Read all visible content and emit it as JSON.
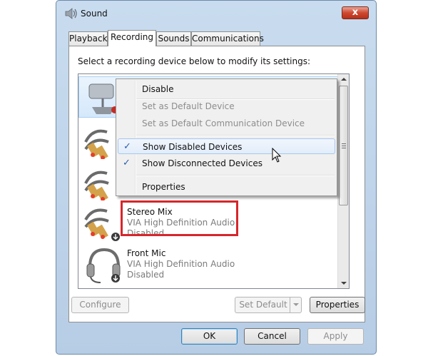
{
  "window": {
    "title": "Sound",
    "close_label": "x"
  },
  "tabs": [
    {
      "label": "Playback",
      "active": false
    },
    {
      "label": "Recording",
      "active": true
    },
    {
      "label": "Sounds",
      "active": false
    },
    {
      "label": "Communications",
      "active": false
    }
  ],
  "panel": {
    "instruction": "Select a recording device below to modify its settings:",
    "devices": [
      {
        "name": "Stereo Mix",
        "sub": "VIA High Definition Audio",
        "status": "Disabled",
        "icon": "stereo-cable-icon",
        "highlighted": true
      },
      {
        "name": "Front Mic",
        "sub": "VIA High Definition Audio",
        "status": "Disabled",
        "icon": "headset-icon",
        "highlighted": false
      }
    ]
  },
  "buttons": {
    "configure": "Configure",
    "set_default": "Set Default",
    "properties": "Properties",
    "ok": "OK",
    "cancel": "Cancel",
    "apply": "Apply"
  },
  "context_menu": {
    "items": [
      {
        "label": "Disable",
        "enabled": true,
        "checked": false
      },
      {
        "label": "Set as Default Device",
        "enabled": false,
        "checked": false
      },
      {
        "label": "Set as Default Communication Device",
        "enabled": false,
        "checked": false
      },
      {
        "label": "Show Disabled Devices",
        "enabled": true,
        "checked": true,
        "hover": true
      },
      {
        "label": "Show Disconnected Devices",
        "enabled": true,
        "checked": true
      },
      {
        "label": "Properties",
        "enabled": true,
        "checked": false
      }
    ],
    "check_glyph": "✓"
  },
  "colors": {
    "highlight_box": "#d6262b",
    "disabled_text": "#7b7b7b",
    "selection": "#d5e8fb"
  }
}
